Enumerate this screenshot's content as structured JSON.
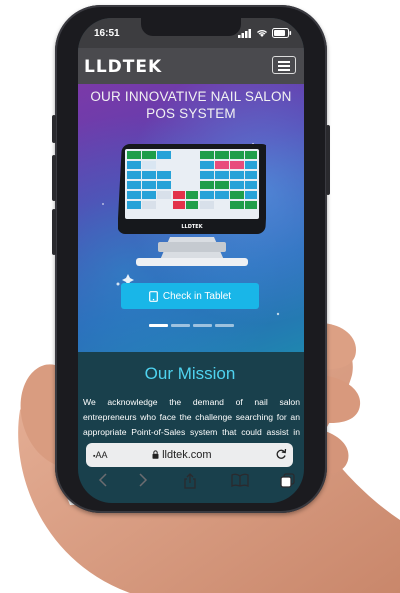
{
  "status_bar": {
    "time": "16:51"
  },
  "header": {
    "logo": "LLDTEK"
  },
  "hero": {
    "title_line1": "OUR INNOVATIVE NAIL SALON",
    "title_line2": "POS SYSTEM",
    "device_brand": "LLDTEK",
    "cta_label": "Check in Tablet",
    "slide_count": 4,
    "active_slide": 0
  },
  "mission": {
    "title": "Our Mission",
    "text": "We acknowledge the demand of nail salon entrepreneurs who face the challenge searching for an appropriate Point-of-Sales system that could assist in enhancing"
  },
  "browser": {
    "aa_label": "AA",
    "url": "lldtek.com"
  },
  "colors": {
    "cta": "#19b6e8",
    "mission_title": "#4fd3f0",
    "navbar": "#4a4a4e"
  }
}
